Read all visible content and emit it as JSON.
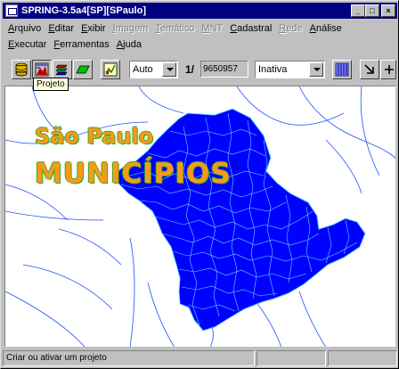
{
  "window": {
    "title": "SPRING-3.5a4[SP][SPaulo]",
    "controls": {
      "minimize": "_",
      "maximize": "□",
      "close": "×"
    }
  },
  "menu": {
    "row1": [
      {
        "label": "Arquivo",
        "enabled": true
      },
      {
        "label": "Editar",
        "enabled": true
      },
      {
        "label": "Exibir",
        "enabled": true
      },
      {
        "label": "Imagem",
        "enabled": false
      },
      {
        "label": "Temático",
        "enabled": false
      },
      {
        "label": "MNT",
        "enabled": false
      },
      {
        "label": "Cadastral",
        "enabled": true
      },
      {
        "label": "Rede",
        "enabled": false
      },
      {
        "label": "Análise",
        "enabled": true
      }
    ],
    "row2": [
      {
        "label": "Executar",
        "enabled": true
      },
      {
        "label": "Ferramentas",
        "enabled": true
      },
      {
        "label": "Ajuda",
        "enabled": true
      }
    ]
  },
  "toolbar": {
    "buttons": [
      {
        "name": "database-icon"
      },
      {
        "name": "project-icon"
      },
      {
        "name": "layers-icon"
      },
      {
        "name": "category-icon"
      },
      {
        "name": "draw-icon"
      }
    ],
    "zoom_select": "Auto",
    "scale_prefix": "1/",
    "scale_value": "9650957",
    "status_select": "Inativa",
    "right_buttons": [
      {
        "name": "grid-icon"
      },
      {
        "name": "arrow-down-right-icon"
      },
      {
        "name": "plus-icon"
      }
    ]
  },
  "tooltip": "Projeto",
  "map": {
    "title_line1": "São Paulo",
    "title_line2": "MUNICÍPIOS",
    "fill_color": "#0000ff",
    "boundary_color": "#70d8ff",
    "river_color": "#2050ff"
  },
  "statusbar": {
    "message": "Criar ou ativar um projeto",
    "cell2": "",
    "cell3": ""
  }
}
